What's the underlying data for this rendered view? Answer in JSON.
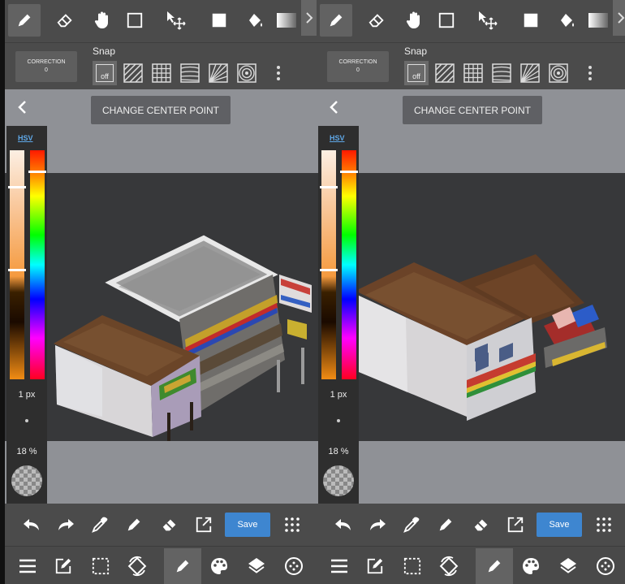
{
  "left_screen": {
    "toolbar": {
      "tools": [
        "pen-icon",
        "eraser-icon",
        "hand-icon",
        "rectangle-select-icon",
        "move-icon",
        "fill-shape-icon",
        "bucket-fill-icon",
        "gradient-icon"
      ],
      "active_tool": "pen-icon"
    },
    "snap": {
      "correction_label": "CORRECTION",
      "correction_value": "0",
      "title": "Snap",
      "off_label": "off"
    },
    "center_button_label": "CHANGE CENTER POINT",
    "panel": {
      "hsv_label": "HSV",
      "brush_size": "1 px",
      "opacity": "18 %"
    },
    "save_label": "Save"
  },
  "right_screen": {
    "toolbar": {
      "tools": [
        "pen-icon",
        "eraser-icon",
        "hand-icon",
        "rectangle-select-icon",
        "move-icon",
        "fill-shape-icon",
        "bucket-fill-icon",
        "gradient-icon"
      ],
      "active_tool": "pen-icon"
    },
    "snap": {
      "correction_label": "CORRECTION",
      "correction_value": "0",
      "title": "Snap",
      "off_label": "off"
    },
    "center_button_label": "CHANGE CENTER POINT",
    "panel": {
      "hsv_label": "HSV",
      "brush_size": "1 px",
      "opacity": "18 %"
    },
    "save_label": "Save"
  },
  "colors": {
    "accent": "#3e86d0",
    "toolbar_bg": "#4b4b4b",
    "canvas_dark": "#37383a",
    "canvas_light": "#8f9196"
  }
}
